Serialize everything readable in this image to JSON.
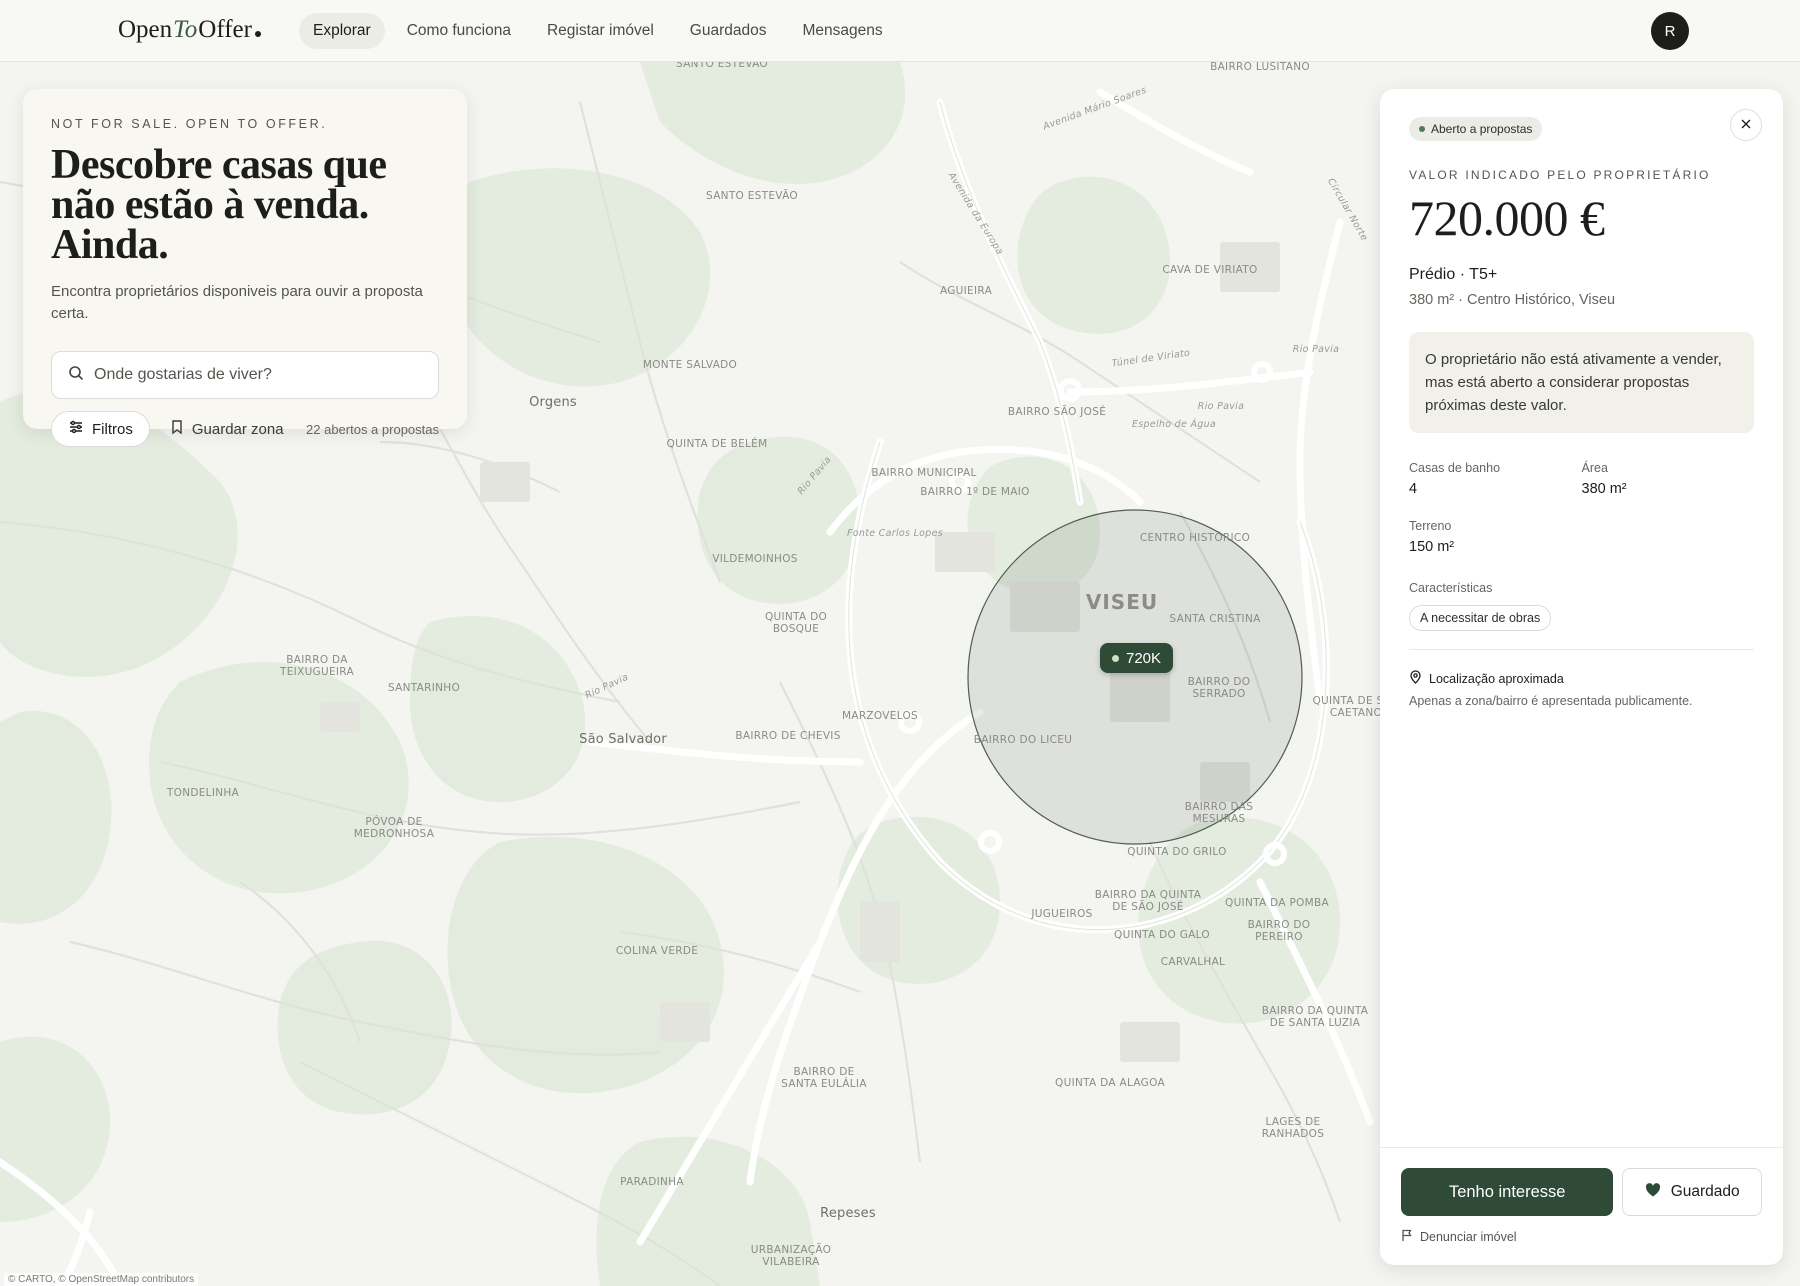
{
  "app": {
    "logo_part1": "Open",
    "logo_part2": "To",
    "logo_part3": "Offer",
    "avatar_initial": "R"
  },
  "nav": {
    "items": [
      "Explorar",
      "Como funciona",
      "Registar imóvel",
      "Guardados",
      "Mensagens"
    ],
    "active": "Explorar"
  },
  "search_card": {
    "eyebrow": "NOT FOR SALE. OPEN TO OFFER.",
    "title": "Descobre casas que não estão à venda. Ainda.",
    "subtitle": "Encontra proprietários disponiveis para ouvir a proposta certa.",
    "search_placeholder": "Onde gostarias de viver?",
    "filters_label": "Filtros",
    "save_zone_label": "Guardar zona",
    "open_count": "22 abertos a propostas"
  },
  "map": {
    "marker_label": "720K",
    "attribution": "© CARTO, © OpenStreetMap contributors",
    "labels": {
      "santo_estevao_top": "SANTO ESTEVÃO",
      "bairro_lusitano": "BAIRRO LUSITANO",
      "santo_estevao": "SANTO ESTEVÃO",
      "aguieira": "AGUIEIRA",
      "cava_viriato": "CAVA DE VIRIATO",
      "monte_salvado": "MONTE SALVADO",
      "orgens": "Orgens",
      "bairro_sao_jose": "BAIRRO SÃO JOSÉ",
      "quinta_belem": "QUINTA DE BELÉM",
      "bairro_municipal": "BAIRRO MUNICIPAL",
      "bairro_1_maio": "BAIRRO 1º DE MAIO",
      "vildemoinhos": "VILDEMOINHOS",
      "centro_historico": "CENTRO HISTÓRICO",
      "viseu": "VISEU",
      "santa_cristina": "SANTA CRISTINA",
      "quinta_bosque": "QUINTA DO BOSQUE",
      "bairro_teixugueira": "BAIRRO DA TEIXUGUEIRA",
      "santarinho": "SANTARINHO",
      "bairro_serrado": "BAIRRO DO SERRADO",
      "quinta_sao_caetano": "QUINTA DE SÃO CAETANO",
      "marzovelos": "MARZOVELOS",
      "bairro_chevis": "BAIRRO DE CHEVIS",
      "sao_salvador": "São Salvador",
      "bairro_liceu": "BAIRRO DO LICEU",
      "tondelinha": "TONDELINHA",
      "povoa_medronhosa": "PÓVOA DE MEDRONHOSA",
      "bairro_mesuras": "BAIRRO DAS MESURAS",
      "quinta_grilo": "QUINTA DO GRILO",
      "bairro_quinta_sao_jose": "BAIRRO DA QUINTA DE SÃO JOSÉ",
      "quinta_pomba": "QUINTA DA POMBA",
      "jugueiros": "JUGUEIROS",
      "bairro_pereiro": "BAIRRO DO PEREIRO",
      "quinta_galo": "QUINTA DO GALO",
      "colina_verde": "COLINA VERDE",
      "carvalhal": "CARVALHAL",
      "bairro_santa_luzia": "BAIRRO DA QUINTA DE SANTA LUZIA",
      "bairro_santa_eulalia": "BAIRRO DE SANTA EULÁLIA",
      "quinta_alagoa": "QUINTA DA ALAGOA",
      "lages_ranhados": "LAGES DE RANHADOS",
      "paradinha": "PARADINHA",
      "repeses": "Repeses",
      "urbanizacao_vilabeira": "URBANIZAÇÃO VILABEIRA",
      "rio_pavia_1": "Rio Pavia",
      "rio_pavia_2": "Rio Pavia",
      "rio_pavia_3": "Rio Pavia",
      "rio_pavia_4": "Rio Pavia",
      "tunel_viriato": "Túnel de Viriato",
      "fonte_carlos_lopes": "Fonte Carlos Lopes",
      "espelho_agua": "Espelho de Água",
      "av_europa": "Avenida da Europa",
      "av_mario_soares": "Avenida Mário Soares",
      "circular_norte": "Circular Norte"
    }
  },
  "panel": {
    "badge": "Aberto a propostas",
    "value_label": "VALOR INDICADO PELO PROPRIETÁRIO",
    "price": "720.000 €",
    "prop_type": "Prédio · T5+",
    "prop_loc": "380 m² · Centro Histórico, Viseu",
    "note": "O proprietário não está ativamente a vender, mas está aberto a considerar propostas próximas deste valor.",
    "stats": [
      {
        "label": "Casas de banho",
        "value": "4"
      },
      {
        "label": "Área",
        "value": "380 m²"
      },
      {
        "label": "Terreno",
        "value": "150 m²"
      }
    ],
    "features_label": "Características",
    "features": [
      "A necessitar de obras"
    ],
    "location_title": "Localização aproximada",
    "location_sub": "Apenas a zona/bairro é apresentada publicamente.",
    "interest_button": "Tenho interesse",
    "saved_button": "Guardado",
    "report_label": "Denunciar imóvel"
  },
  "colors": {
    "accent": "#2f4a37",
    "background": "#f3f3ef",
    "map_green": "#dfe8d8"
  }
}
